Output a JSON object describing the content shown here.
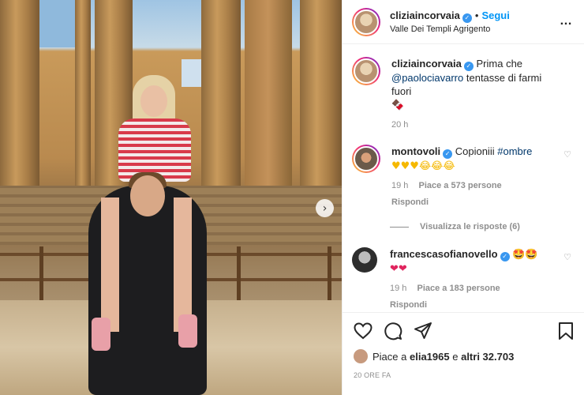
{
  "post": {
    "username": "cliziaincorvaia",
    "follow_label": "Segui",
    "dot": "•",
    "location": "Valle Dei Templi Agrigento",
    "more_icon": "…"
  },
  "caption": {
    "username": "cliziaincorvaia",
    "text_before": "Prima che",
    "mention": "@paolociavarro",
    "text_after": "tentasse di farmi fuori",
    "emoji": "🍫",
    "time": "20 h"
  },
  "comments": [
    {
      "username": "montovoli",
      "text": "Copioniii",
      "hashtag": "#ombre",
      "line2": "♥♥♥😂😂😂",
      "time": "19 h",
      "likes": "Piace a 573 persone",
      "reply": "Rispondi",
      "avatar_color": "#6b5a4a"
    },
    {
      "username": "francescasofianovello",
      "emoji": "🤩🤩",
      "line2": "❤❤",
      "time": "19 h",
      "likes": "Piace a 183 persone",
      "reply": "Rispondi",
      "avatar_color": "#2d2d2d"
    }
  ],
  "show_replies": "Visualizza le risposte (6)",
  "likes_summary": {
    "prefix": "Piace a",
    "user": "elia1965",
    "middle": "e",
    "others": "altri 32.703"
  },
  "posted_ago": "20 ORE FA",
  "next_icon": "›",
  "heart_small": "♡",
  "verified_glyph": "✓"
}
